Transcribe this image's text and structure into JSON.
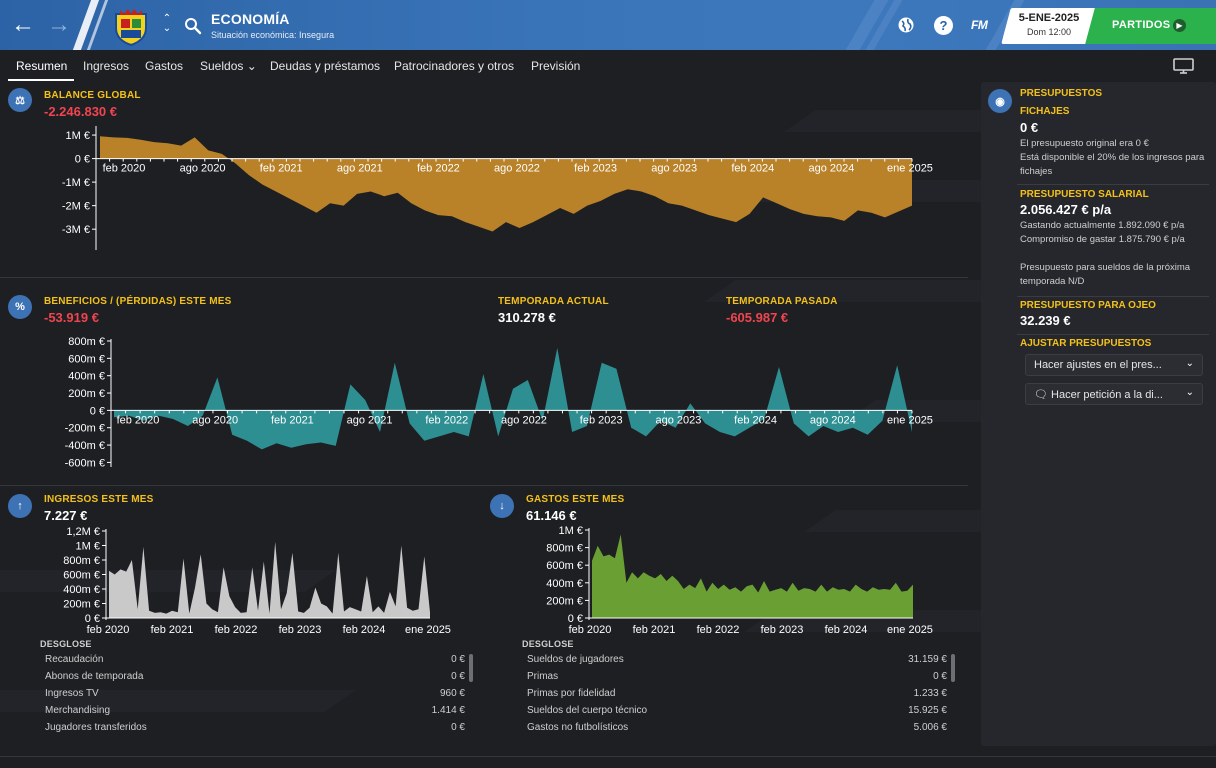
{
  "header": {
    "title": "ECONOMÍA",
    "subtitle": "Situación económica: Insegura",
    "date": "5-ENE-2025",
    "date_sub": "Dom 12:00",
    "continue_label": "PARTIDOS",
    "fm_logo": "FM",
    "help_label": "?"
  },
  "tabs": [
    {
      "label": "Resumen",
      "active": true
    },
    {
      "label": "Ingresos"
    },
    {
      "label": "Gastos"
    },
    {
      "label": "Sueldos ⌄"
    },
    {
      "label": "Deudas y préstamos"
    },
    {
      "label": "Patrocinadores y otros"
    },
    {
      "label": "Previsión"
    }
  ],
  "balance": {
    "title": "BALANCE GLOBAL",
    "value": "-2.246.830 €"
  },
  "profit": {
    "title": "BENEFICIOS / (PÉRDIDAS) ESTE MES",
    "value": "-53.919 €",
    "current_title": "TEMPORADA ACTUAL",
    "current_value": "310.278 €",
    "last_title": "TEMPORADA PASADA",
    "last_value": "-605.987 €"
  },
  "income": {
    "title": "INGRESOS ESTE MES",
    "value": "7.227 €",
    "breakdown_title": "DESGLOSE",
    "rows": [
      {
        "label": "Recaudación",
        "value": "0 €"
      },
      {
        "label": "Abonos de temporada",
        "value": "0 €"
      },
      {
        "label": "Ingresos TV",
        "value": "960 €"
      },
      {
        "label": "Merchandising",
        "value": "1.414 €"
      },
      {
        "label": "Jugadores transferidos",
        "value": "0 €"
      }
    ]
  },
  "expenses": {
    "title": "GASTOS ESTE MES",
    "value": "61.146 €",
    "breakdown_title": "DESGLOSE",
    "rows": [
      {
        "label": "Sueldos de jugadores",
        "value": "31.159 €"
      },
      {
        "label": "Primas",
        "value": "0 €"
      },
      {
        "label": "Primas por fidelidad",
        "value": "1.233 €"
      },
      {
        "label": "Sueldos del cuerpo técnico",
        "value": "15.925 €"
      },
      {
        "label": "Gastos no futbolísticos",
        "value": "5.006 €"
      }
    ]
  },
  "budgets": {
    "title": "PRESUPUESTOS",
    "transfer_title": "FICHAJES",
    "transfer_value": "0 €",
    "transfer_note1": "El presupuesto original era 0 €",
    "transfer_note2": "Está disponible el 20% de los ingresos para fichajes",
    "wage_title": "PRESUPUESTO SALARIAL",
    "wage_value": "2.056.427 € p/a",
    "wage_note1": "Gastando actualmente 1.892.090 € p/a",
    "wage_note2": "Compromiso de gastar 1.875.790 € p/a",
    "wage_note3": "Presupuesto para sueldos de la próxima temporada N/D",
    "scout_title": "PRESUPUESTO PARA OJEO",
    "scout_value": "32.239 €",
    "adjust_title": "AJUSTAR PRESUPUESTOS",
    "adjust_dropdown": "Hacer ajustes en el pres...",
    "request_dropdown": "Hacer petición a la di..."
  },
  "colors": {
    "balance_fill": "#b98229",
    "profit_fill": "#2e8f92",
    "income_fill": "#c9c9c9",
    "expense_fill": "#6aa033",
    "negative_text": "#f0454f",
    "section_title": "#f3c119",
    "continue_green": "#2bb24c"
  },
  "chart_data": [
    {
      "type": "area",
      "name": "balance",
      "yticks": [
        "1M €",
        "0 €",
        "-1M €",
        "-2M €",
        "-3M €"
      ],
      "ytick_values": [
        1000000,
        0,
        -1000000,
        -2000000,
        -3000000
      ],
      "xticks": [
        "feb 2020",
        "ago 2020",
        "feb 2021",
        "ago 2021",
        "feb 2022",
        "ago 2022",
        "feb 2023",
        "ago 2023",
        "feb 2024",
        "ago 2024",
        "ene 2025"
      ],
      "ylim": [
        -3800000,
        1300000
      ],
      "values": [
        950000,
        900000,
        880000,
        800000,
        700000,
        650000,
        550000,
        900000,
        350000,
        200000,
        -200000,
        -700000,
        -1100000,
        -1400000,
        -1700000,
        -2000000,
        -2300000,
        -1900000,
        -2000000,
        -1500000,
        -1400000,
        -1600000,
        -1450000,
        -1900000,
        -2200000,
        -2400000,
        -2450000,
        -2700000,
        -2900000,
        -3100000,
        -2700000,
        -2950000,
        -2700000,
        -2400000,
        -2100000,
        -2350000,
        -2000000,
        -1800000,
        -1500000,
        -1300000,
        -1400000,
        -1600000,
        -1900000,
        -2000000,
        -2200000,
        -2400000,
        -2550000,
        -2700000,
        -2350000,
        -1650000,
        -1900000,
        -2150000,
        -2350000,
        -2450000,
        -2500000,
        -2650000,
        -2200000,
        -2300000,
        -2500000,
        -2250000,
        -2000000
      ]
    },
    {
      "type": "area",
      "name": "profit_per_month",
      "yticks": [
        "800m €",
        "600m €",
        "400m €",
        "200m €",
        "0 €",
        "-200m €",
        "-400m €",
        "-600m €"
      ],
      "ytick_values": [
        800000,
        600000,
        400000,
        200000,
        0,
        -200000,
        -400000,
        -600000
      ],
      "xticks": [
        "feb 2020",
        "ago 2020",
        "feb 2021",
        "ago 2021",
        "feb 2022",
        "ago 2022",
        "feb 2023",
        "ago 2023",
        "feb 2024",
        "ago 2024",
        "ene 2025"
      ],
      "ylim": [
        -630000,
        800000
      ],
      "values": [
        -80000,
        -60000,
        -120000,
        -60000,
        -100000,
        -180000,
        -60000,
        380000,
        -280000,
        -350000,
        -450000,
        -380000,
        -430000,
        -390000,
        -370000,
        -410000,
        300000,
        120000,
        -250000,
        550000,
        -150000,
        -350000,
        -300000,
        -250000,
        -300000,
        420000,
        -300000,
        250000,
        350000,
        -120000,
        720000,
        -250000,
        -180000,
        550000,
        480000,
        -200000,
        -300000,
        -120000,
        -200000,
        80000,
        -150000,
        -250000,
        -300000,
        -200000,
        -100000,
        500000,
        -150000,
        -300000,
        -180000,
        -250000,
        -200000,
        -280000,
        -120000,
        520000,
        -250000
      ],
      "series_label": "",
      "xlabel": ""
    },
    {
      "type": "area",
      "name": "income_per_month",
      "yticks": [
        "1,2M €",
        "1M €",
        "800m €",
        "600m €",
        "400m €",
        "200m €",
        "0 €"
      ],
      "ytick_values": [
        1200000,
        1000000,
        800000,
        600000,
        400000,
        200000,
        0
      ],
      "xticks": [
        "feb 2020",
        "feb 2021",
        "feb 2022",
        "feb 2023",
        "feb 2024",
        "ene 2025"
      ],
      "ylim": [
        0,
        1200000
      ],
      "values": [
        650000,
        600000,
        670000,
        640000,
        800000,
        120000,
        980000,
        100000,
        70000,
        80000,
        60000,
        100000,
        80000,
        820000,
        60000,
        420000,
        880000,
        200000,
        120000,
        80000,
        700000,
        300000,
        150000,
        70000,
        80000,
        700000,
        100000,
        780000,
        60000,
        1050000,
        120000,
        340000,
        900000,
        90000,
        70000,
        140000,
        420000,
        200000,
        160000,
        60000,
        900000,
        90000,
        150000,
        120000,
        90000,
        580000,
        80000,
        160000,
        70000,
        360000,
        160000,
        1000000,
        140000,
        100000,
        120000,
        850000,
        80000
      ]
    },
    {
      "type": "area",
      "name": "expenses_per_month",
      "yticks": [
        "1M €",
        "800m €",
        "600m €",
        "400m €",
        "200m €",
        "0 €"
      ],
      "ytick_values": [
        1000000,
        800000,
        600000,
        400000,
        200000,
        0
      ],
      "xticks": [
        "feb 2020",
        "feb 2021",
        "feb 2022",
        "feb 2023",
        "feb 2024",
        "ene 2025"
      ],
      "ylim": [
        0,
        1000000
      ],
      "values": [
        650000,
        820000,
        700000,
        720000,
        680000,
        950000,
        400000,
        520000,
        450000,
        520000,
        480000,
        450000,
        500000,
        420000,
        480000,
        420000,
        330000,
        380000,
        340000,
        450000,
        300000,
        400000,
        330000,
        380000,
        320000,
        350000,
        300000,
        360000,
        380000,
        290000,
        420000,
        300000,
        320000,
        340000,
        300000,
        400000,
        310000,
        340000,
        330000,
        300000,
        380000,
        300000,
        350000,
        320000,
        330000,
        300000,
        380000,
        330000,
        300000,
        350000,
        320000,
        330000,
        320000,
        400000,
        300000,
        310000,
        380000
      ]
    }
  ]
}
